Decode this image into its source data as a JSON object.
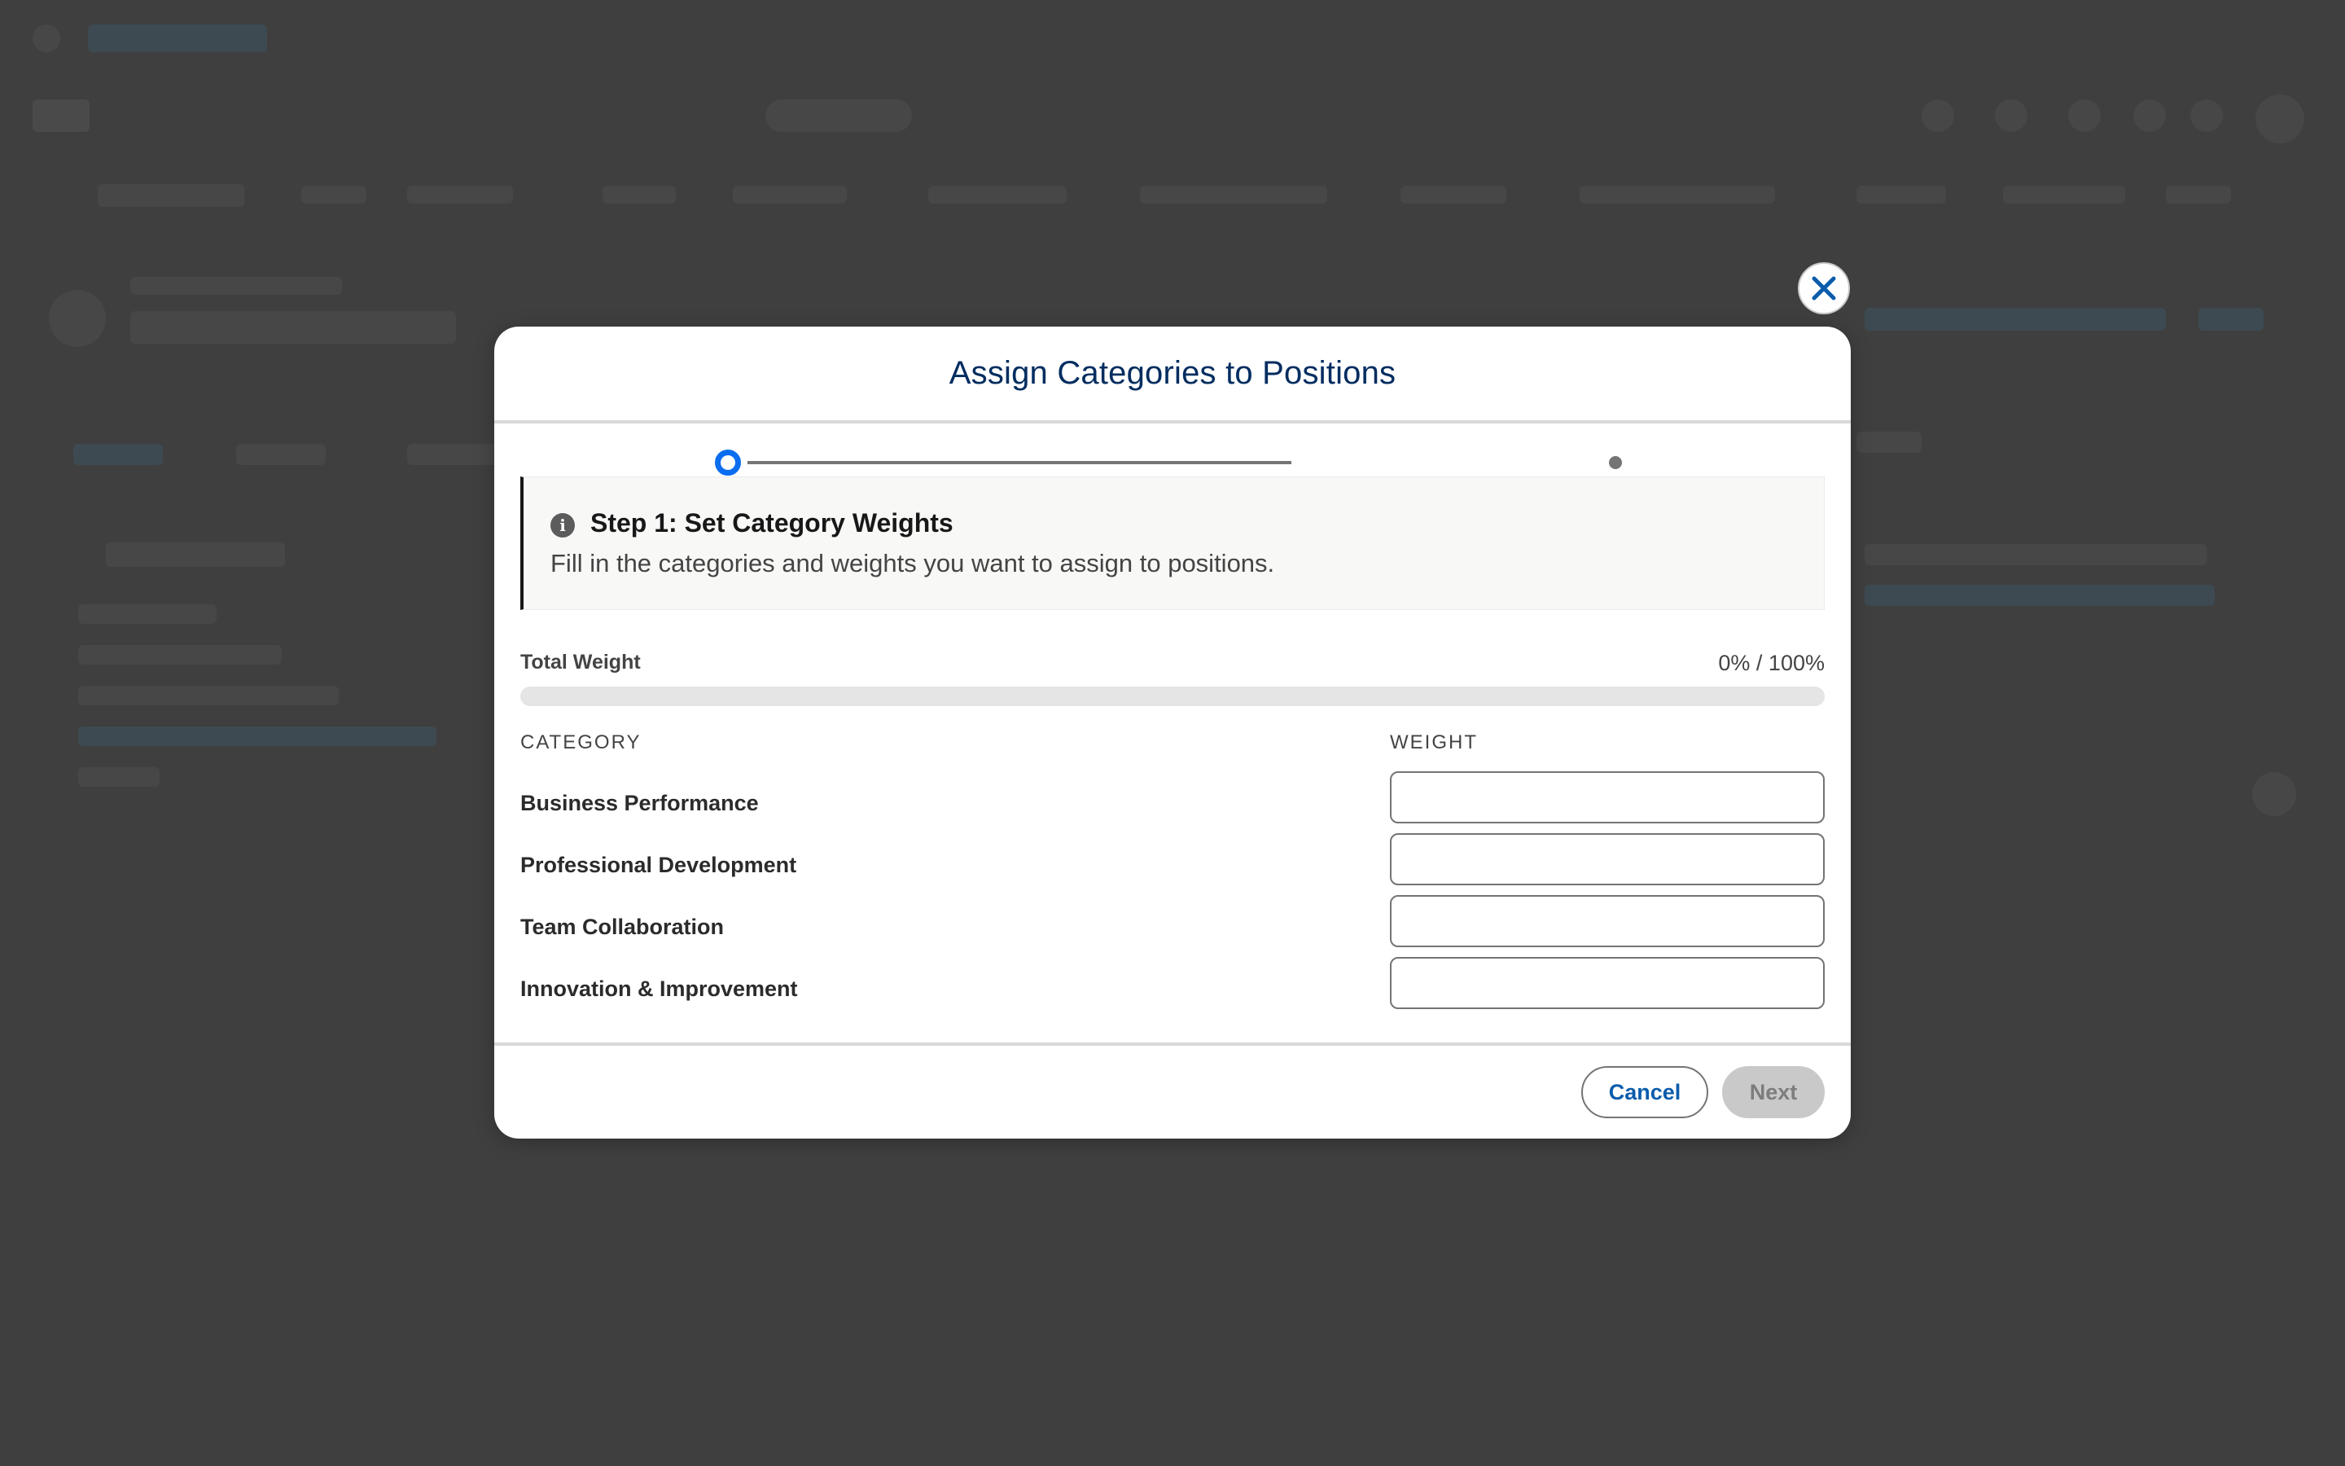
{
  "modal": {
    "title": "Assign Categories to Positions",
    "close_icon": "close-icon",
    "stepper": {
      "current_step": 1,
      "total_steps": 2
    },
    "info": {
      "icon": "info-icon",
      "icon_glyph": "i",
      "heading": "Step 1: Set Category Weights",
      "text": "Fill in the categories and weights you want to assign to positions."
    },
    "total_weight": {
      "label": "Total Weight",
      "value_text": "0% / 100%",
      "percent": 0
    },
    "table": {
      "category_header": "CATEGORY",
      "weight_header": "WEIGHT",
      "rows": [
        {
          "category": "Business Performance",
          "weight": ""
        },
        {
          "category": "Professional Development",
          "weight": ""
        },
        {
          "category": "Team Collaboration",
          "weight": ""
        },
        {
          "category": "Innovation & Improvement",
          "weight": ""
        }
      ]
    },
    "footer": {
      "cancel_label": "Cancel",
      "next_label": "Next",
      "next_disabled": true
    }
  },
  "colors": {
    "accent": "#0b6df0",
    "title": "#032d60",
    "link": "#0b5cab",
    "overlay": "#3e3e3e"
  }
}
